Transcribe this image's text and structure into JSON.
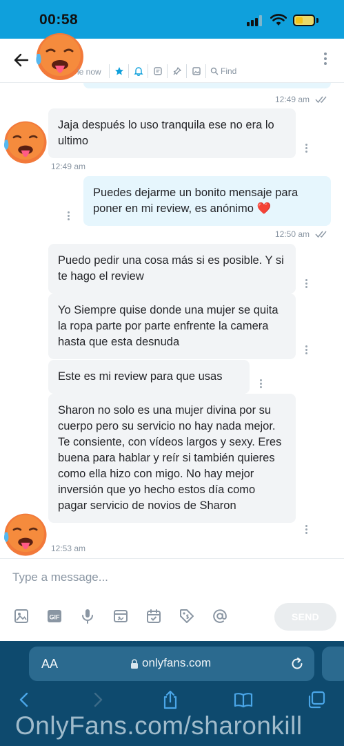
{
  "status_bar": {
    "time": "00:58"
  },
  "header": {
    "status_text": "le now",
    "find_label": "Find"
  },
  "messages": [
    {
      "id": "m0",
      "time": "12:49 am"
    },
    {
      "id": "m1",
      "text": "Jaja después lo uso tranquila ese no era lo ultimo",
      "time": "12:49 am"
    },
    {
      "id": "m2",
      "text": "Puedes dejarme un bonito mensaje para poner en mi review, es anónimo ❤️",
      "time": "12:50 am"
    },
    {
      "id": "m3",
      "text": "Puedo pedir una cosa más si es posible. Y si te hago el review"
    },
    {
      "id": "m4",
      "text": "Yo Siempre quise donde una mujer se quita la ropa parte por parte enfrente la camera hasta que esta desnuda"
    },
    {
      "id": "m5",
      "text": "Este es mi review para que usas"
    },
    {
      "id": "m6",
      "text": "Sharon no solo es una mujer divina por su cuerpo pero su servicio no hay nada mejor. Te consiente, con vídeos largos y sexy. Eres buena para hablar y reír si también quieres como ella hizo con migo. No hay mejor inversión que yo hecho estos día como pagar servicio de novios de Sharon",
      "time": "12:53 am"
    }
  ],
  "composer": {
    "placeholder": "Type a message...",
    "send_label": "SEND",
    "gif_label": "GIF"
  },
  "safari": {
    "aa_label": "AA",
    "url": "onlyfans.com"
  },
  "watermark": "OnlyFans.com/sharonkill",
  "colors": {
    "brand": "#0fa0dc",
    "incoming_bubble": "#f2f4f6",
    "outgoing_bubble": "#e6f6fd",
    "safari_bar": "#0e4a6e"
  }
}
